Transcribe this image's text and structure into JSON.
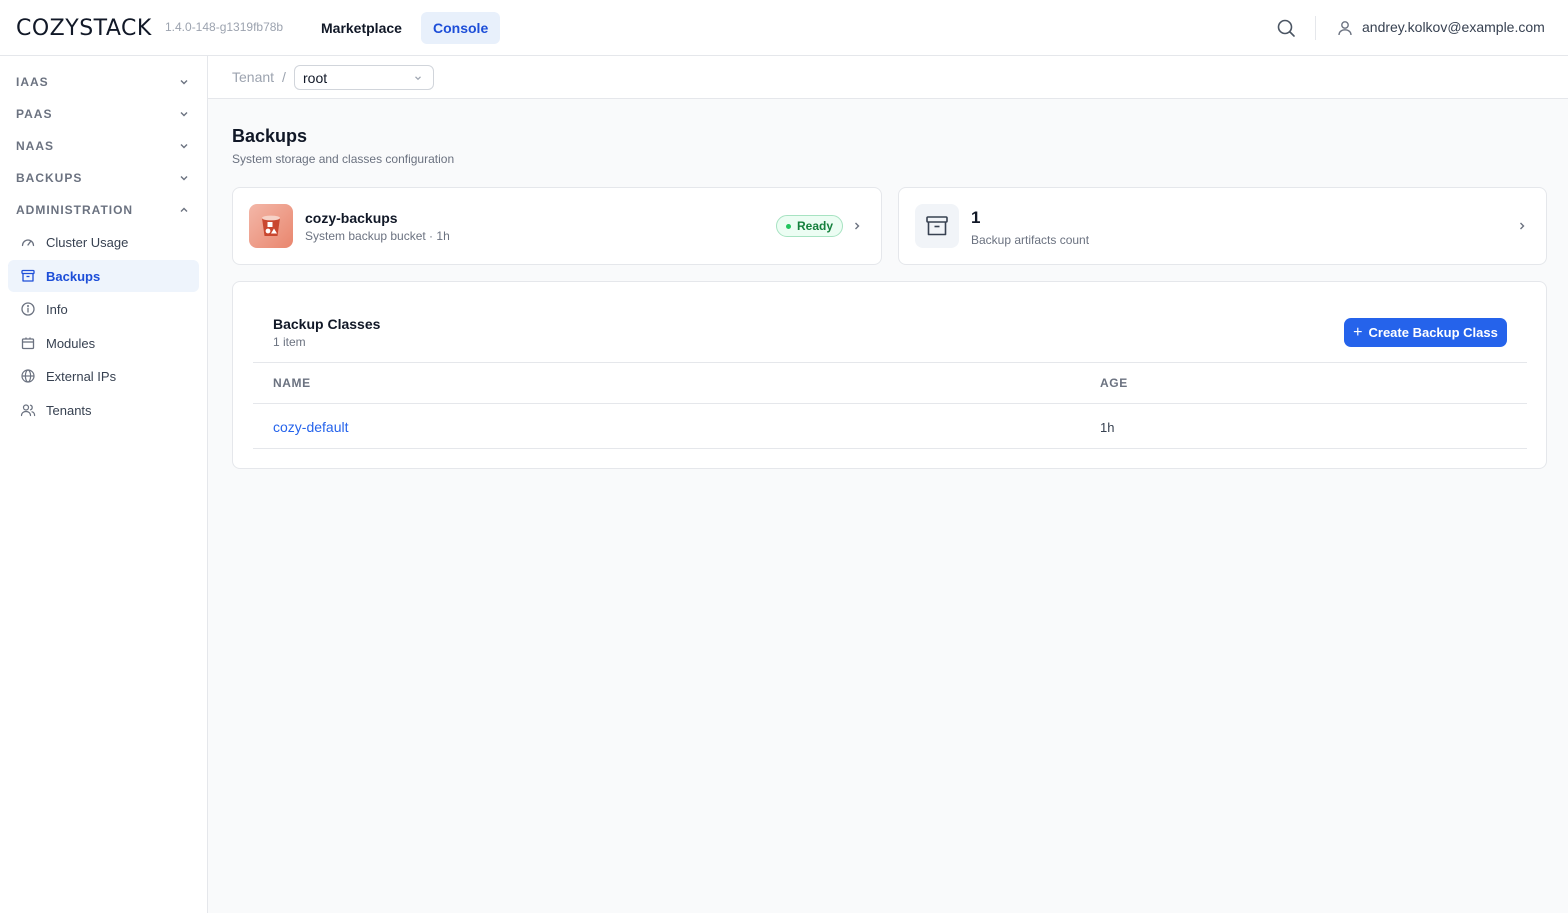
{
  "app": {
    "logo": "COZYSTACK",
    "version": "1.4.0-148-g1319fb78b"
  },
  "top_nav": {
    "marketplace": "Marketplace",
    "console": "Console",
    "user_email": "andrey.kolkov@example.com"
  },
  "sidebar": {
    "sections": [
      {
        "label": "IAAS",
        "expanded": false
      },
      {
        "label": "PAAS",
        "expanded": false
      },
      {
        "label": "NAAS",
        "expanded": false
      },
      {
        "label": "BACKUPS",
        "expanded": false
      },
      {
        "label": "ADMINISTRATION",
        "expanded": true
      }
    ],
    "items": [
      {
        "label": "Cluster Usage",
        "icon": "gauge-icon"
      },
      {
        "label": "Backups",
        "icon": "archive-icon",
        "active": true
      },
      {
        "label": "Info",
        "icon": "info-icon"
      },
      {
        "label": "Modules",
        "icon": "package-icon"
      },
      {
        "label": "External IPs",
        "icon": "globe-icon"
      },
      {
        "label": "Tenants",
        "icon": "users-icon"
      }
    ]
  },
  "breadcrumb": {
    "tenant_label": "Tenant",
    "separator": "/",
    "tenant_value": "root"
  },
  "page": {
    "title": "Backups",
    "subtitle": "System storage and classes configuration"
  },
  "bucket_card": {
    "name": "cozy-backups",
    "meta": "System backup bucket · 1h",
    "status": "Ready"
  },
  "artifacts_card": {
    "count": "1",
    "label": "Backup artifacts count"
  },
  "backup_classes": {
    "title": "Backup Classes",
    "count_text": "1 item",
    "create_button": "Create Backup Class",
    "columns": [
      "NAME",
      "AGE"
    ],
    "rows": [
      {
        "name": "cozy-default",
        "age": "1h"
      }
    ]
  },
  "colors": {
    "accent": "#2563eb",
    "status_ready": "#22c55e",
    "bucket_icon": "#e9866e"
  }
}
